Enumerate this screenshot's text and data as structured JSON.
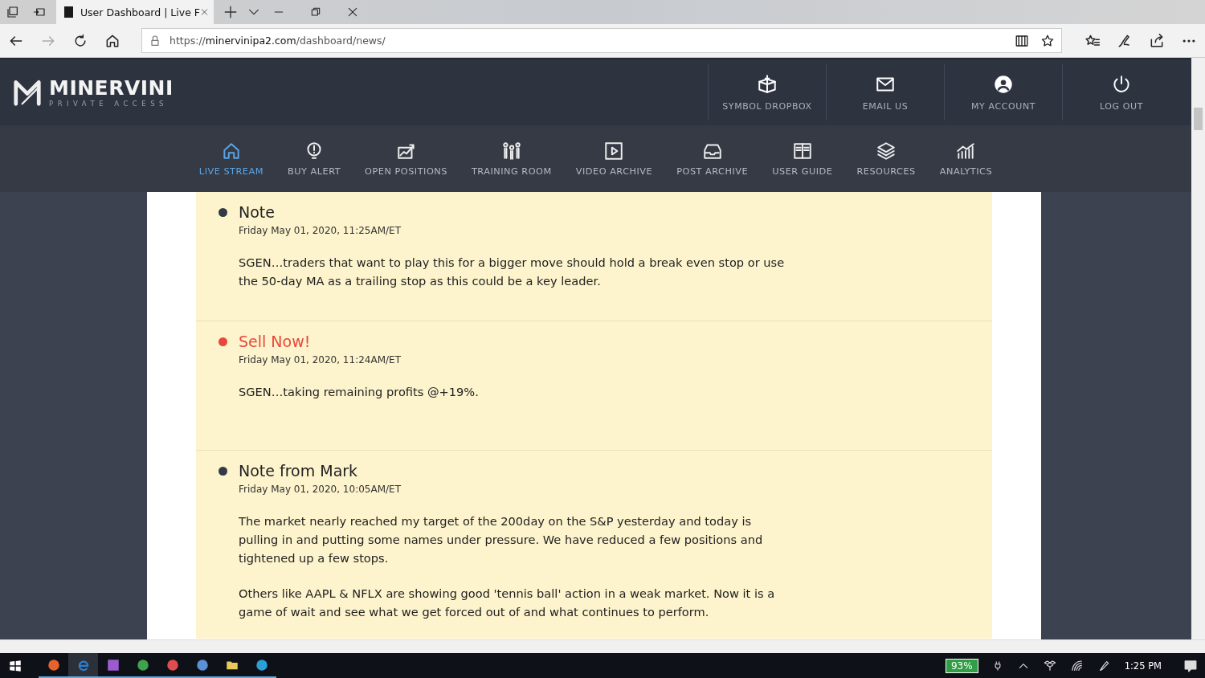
{
  "browser": {
    "tab_title": "User Dashboard | Live F",
    "url_scheme": "https://",
    "url_host": "minervinipa2.com",
    "url_path": "/dashboard/news/"
  },
  "site_header": {
    "logo_name": "MINERVINI",
    "logo_tagline": "PRIVATE ACCESS",
    "actions": [
      {
        "label": "SYMBOL DROPBOX"
      },
      {
        "label": "EMAIL US"
      },
      {
        "label": "MY ACCOUNT"
      },
      {
        "label": "LOG OUT"
      }
    ]
  },
  "nav": [
    {
      "label": "LIVE STREAM",
      "selected": true
    },
    {
      "label": "BUY ALERT",
      "selected": false
    },
    {
      "label": "OPEN POSITIONS",
      "selected": false
    },
    {
      "label": "TRAINING ROOM",
      "selected": false
    },
    {
      "label": "VIDEO ARCHIVE",
      "selected": false
    },
    {
      "label": "POST ARCHIVE",
      "selected": false
    },
    {
      "label": "USER GUIDE",
      "selected": false
    },
    {
      "label": "RESOURCES",
      "selected": false
    },
    {
      "label": "ANALYTICS",
      "selected": false
    }
  ],
  "feed": [
    {
      "kind": "note",
      "color": "#333a47",
      "title": "Note",
      "date": "Friday May 01, 2020, 11:25AM/ET",
      "paragraphs": [
        "SGEN…traders that want to play this for a bigger move should hold a break even stop or use the 50-day MA as a trailing stop as this could be a key leader."
      ]
    },
    {
      "kind": "sell",
      "color": "#e8483b",
      "title": "Sell Now!",
      "date": "Friday May 01, 2020, 11:24AM/ET",
      "paragraphs": [
        "SGEN…taking remaining profits @+19%."
      ]
    },
    {
      "kind": "note",
      "color": "#333a47",
      "title": "Note from Mark",
      "date": "Friday May 01, 2020, 10:05AM/ET",
      "paragraphs": [
        "The market nearly reached my target of the 200day on the S&P yesterday and today is pulling in and putting some names under pressure.  We have reduced a few positions and tightened up a few stops.",
        "Others like AAPL & NFLX are showing good 'tennis ball' action in a weak market.  Now it is a game of wait and see what we get forced out of and what continues to perform."
      ]
    }
  ],
  "taskbar": {
    "battery": "93%",
    "time": "1:25 PM"
  }
}
